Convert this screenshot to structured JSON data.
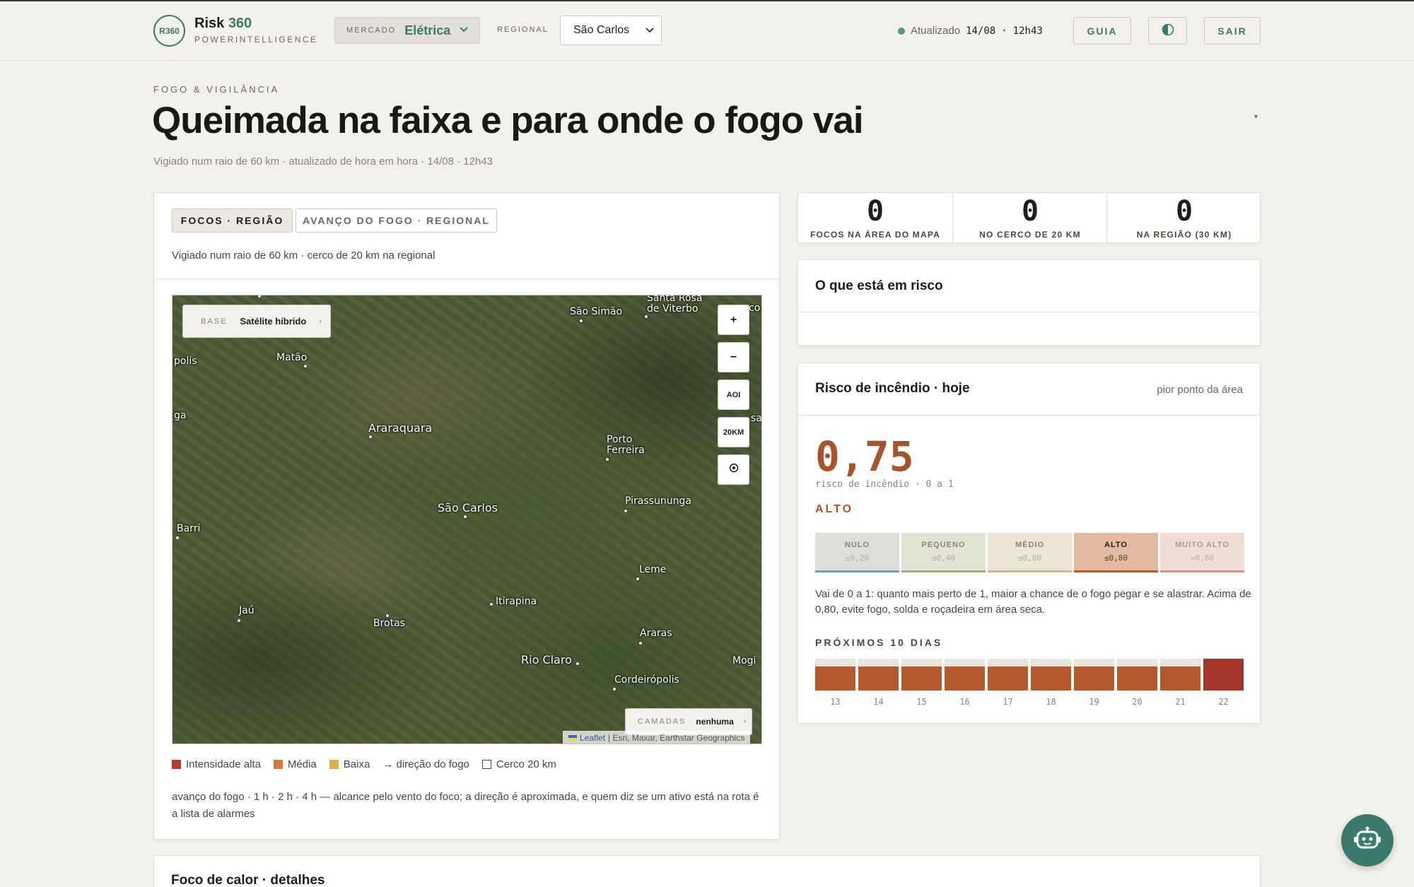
{
  "header": {
    "logo_badge": "R360",
    "logo_name": "Risk",
    "logo_num": "360",
    "logo_sub": "POWERINTELLIGENCE",
    "market_label": "MERCADO",
    "market_value": "Elétrica",
    "regional_label": "REGIONAL",
    "regional_value": "São Carlos",
    "status_label": "Atualizado",
    "status_date": "14/08",
    "status_sep": "·",
    "status_time": "12h43",
    "guide_label": "GUIA",
    "theme_icon": "contrast-icon",
    "logout_label": "SAIR"
  },
  "page": {
    "eyebrow": "FOGO & VIGILÂNCIA",
    "title": "Queimada na faixa e para onde o fogo vai",
    "caret": "▾",
    "subtitle": "Vigiado num raio de 60 km · atualizado de hora em hora · 14/08 · 12h43"
  },
  "map_card": {
    "tabs": [
      "FOCOS · REGIÃO",
      "AVANÇO DO FOGO · REGIONAL"
    ],
    "active_tab": 0,
    "note": "Vigiado num raio de 60 km · cerco de 20 km na regional",
    "base_label": "BASE",
    "base_value": "Satélite híbrido",
    "base_caret": "›",
    "layers_label": "CAMADAS",
    "layers_value": "nenhuma",
    "layers_caret": "›",
    "attrib_leaflet": "Leaflet",
    "attrib_rest": "| Esri, Maxar, Earthstar Geographics",
    "controls": [
      "+",
      "−",
      "AOI",
      "20KM",
      "◎"
    ],
    "cities": [
      "Santa Rosa",
      "de Viterbo",
      "São Simão",
      "polis",
      "Matão",
      "ga",
      "Araraquara",
      "Porto",
      "Ferreira",
      "sa",
      "São Carlos",
      "Pirassununga",
      "Barri",
      "Leme",
      "Itirapina",
      "Jaú",
      "Brotas",
      "Araras",
      "Rio Claro",
      "Mogi",
      "Cordeirópolis",
      "co"
    ],
    "legend": [
      {
        "label": "Intensidade alta",
        "color": "#b8392b"
      },
      {
        "label": "Média",
        "color": "#d9783a"
      },
      {
        "label": "Baixa",
        "color": "#e2b14a"
      },
      {
        "label": "→ direção do fogo",
        "color": ""
      },
      {
        "label": "Cerco 20 km",
        "color": ""
      }
    ],
    "footnote": "avanço do fogo · 1 h · 2 h · 4 h — alcance pelo vento do foco; a direção é aproximada, e quem diz se um ativo está na rota é a lista de alarmes"
  },
  "stats": [
    {
      "value": "0",
      "label": "FOCOS NA ÁREA DO MAPA"
    },
    {
      "value": "0",
      "label": "NO CERCO DE 20 KM"
    },
    {
      "value": "0",
      "label": "NA REGIÃO (30 KM)"
    }
  ],
  "risk_assets": {
    "title": "O que está em risco"
  },
  "fire_risk": {
    "title": "Risco de incêndio · hoje",
    "right_note": "pior ponto da área",
    "value": "0,75",
    "scale": "risco de incêndio · 0 a 1",
    "level": "ALTO",
    "categories": [
      {
        "name": "NULO",
        "threshold": "≤0,20",
        "bg": "#dcdfd8",
        "line": "#6fa59a",
        "fg": "#8a857b"
      },
      {
        "name": "PEQUENO",
        "threshold": "≤0,40",
        "bg": "#e3e3d4",
        "line": "#9db07a",
        "fg": "#8a857b"
      },
      {
        "name": "MÉDIO",
        "threshold": "≤0,60",
        "bg": "#ece5d6",
        "line": "#d2b58a",
        "fg": "#8a857b"
      },
      {
        "name": "ALTO",
        "threshold": "≤0,80",
        "bg": "#e3b9a0",
        "line": "#b5582a",
        "fg": "#1f1d1a"
      },
      {
        "name": "MUITO ALTO",
        "threshold": ">0,80",
        "bg": "#efddd6",
        "line": "#d3948a",
        "fg": "#a59d92"
      }
    ],
    "description": "Vai de 0 a 1: quanto mais perto de 1, maior a chance de o fogo pegar e se alastrar. Acima de 0,80, evite fogo, solda e roçadeira em área seca.",
    "next_label": "PRÓXIMOS 10 DIAS",
    "forecast": [
      {
        "day": "13",
        "value": 0.75,
        "color": "#b5582a"
      },
      {
        "day": "14",
        "value": 0.75,
        "color": "#b5582a"
      },
      {
        "day": "15",
        "value": 0.75,
        "color": "#b5582a"
      },
      {
        "day": "16",
        "value": 0.75,
        "color": "#b5582a"
      },
      {
        "day": "17",
        "value": 0.75,
        "color": "#b5582a"
      },
      {
        "day": "18",
        "value": 0.75,
        "color": "#b5582a"
      },
      {
        "day": "19",
        "value": 0.75,
        "color": "#b5582a"
      },
      {
        "day": "20",
        "value": 0.75,
        "color": "#b5582a"
      },
      {
        "day": "21",
        "value": 0.75,
        "color": "#b5582a"
      },
      {
        "day": "22",
        "value": 1.0,
        "color": "#a5352a"
      }
    ]
  },
  "detail_card": {
    "title": "Foco de calor · detalhes"
  },
  "assistant": {
    "icon": "robot-icon"
  }
}
